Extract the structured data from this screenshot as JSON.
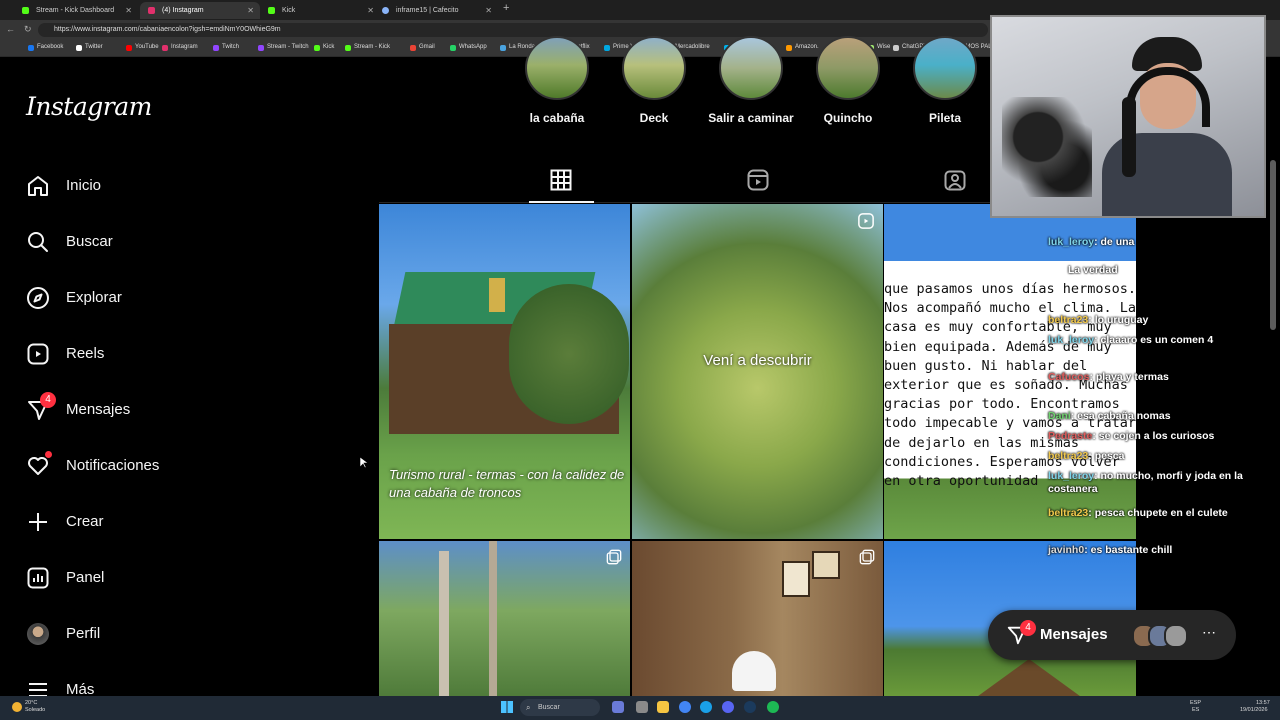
{
  "browser": {
    "tabs": [
      {
        "label": "Stream - Kick Dashboard",
        "color": "#53fc18"
      },
      {
        "label": "(4) Instagram",
        "color": "#e1306c"
      },
      {
        "label": "Kick",
        "color": "#53fc18"
      },
      {
        "label": "inframe15 | Cafecito",
        "color": "#8ab4f8"
      }
    ],
    "url": "https://www.instagram.com/cabaniaencolon?igsh=emdiNmY0OWhieG9m",
    "bookmarks": [
      {
        "label": "Facebook",
        "color": "#1877f2"
      },
      {
        "label": "Twitter",
        "color": "#ffffff"
      },
      {
        "label": "YouTube",
        "color": "#ff0000"
      },
      {
        "label": "Instagram",
        "color": "#e1306c"
      },
      {
        "label": "Twitch",
        "color": "#9146ff"
      },
      {
        "label": "Stream - Twitch",
        "color": "#9146ff"
      },
      {
        "label": "Kick",
        "color": "#53fc18"
      },
      {
        "label": "Stream - Kick",
        "color": "#53fc18"
      },
      {
        "label": "Gmail",
        "color": "#ea4335"
      },
      {
        "label": "WhatsApp",
        "color": "#25d366"
      },
      {
        "label": "La Ronda Simracing",
        "color": "#4aa3df"
      },
      {
        "label": "Netflix",
        "color": "#e50914"
      },
      {
        "label": "Prime Video",
        "color": "#00a8e1"
      },
      {
        "label": "Mercadolibre",
        "color": "#ffe600"
      },
      {
        "label": "Mercadopago",
        "color": "#00b1ea"
      },
      {
        "label": "Amazon.",
        "color": "#ff9900"
      },
      {
        "label": "PayPal",
        "color": "#0070ba"
      },
      {
        "label": "Wise",
        "color": "#9fe870"
      },
      {
        "label": "ChatGPT",
        "color": "#cccccc"
      },
      {
        "label": "DEMOS PAL STR",
        "color": "#cccccc"
      }
    ]
  },
  "sidebar": {
    "logo": "Instagram",
    "items": [
      {
        "label": "Inicio",
        "icon": "home-icon"
      },
      {
        "label": "Buscar",
        "icon": "search-icon"
      },
      {
        "label": "Explorar",
        "icon": "compass-icon"
      },
      {
        "label": "Reels",
        "icon": "reels-icon"
      },
      {
        "label": "Mensajes",
        "icon": "messenger-icon",
        "badge": "4"
      },
      {
        "label": "Notificaciones",
        "icon": "heart-icon"
      },
      {
        "label": "Crear",
        "icon": "plus-icon"
      },
      {
        "label": "Panel",
        "icon": "dashboard-icon"
      },
      {
        "label": "Perfil",
        "icon": "avatar"
      },
      {
        "label": "Más",
        "icon": "menu-icon"
      }
    ]
  },
  "highlights": [
    {
      "label": "la cabaña"
    },
    {
      "label": "Deck"
    },
    {
      "label": "Salir a caminar"
    },
    {
      "label": "Quincho"
    },
    {
      "label": "Pileta"
    }
  ],
  "profile_tabs": [
    "grid-icon",
    "reels-icon",
    "tagged-icon"
  ],
  "posts": [
    {
      "overlay": "Turismo rural - termas - con la calidez de una cabaña de troncos"
    },
    {
      "overlay": "Vení a descubrir"
    },
    {
      "overlay": "que pasamos unos días hermosos. Nos acompañó mucho el clima. La casa es muy confortable, muy bien equipada. Además de muy buen gusto. Ni hablar del exterior que es soñado. Muchas gracias por todo. Encontramos todo impecable y vamos a tratar de dejarlo en las mismas condiciones. Esperamos volver en otra oportunidad"
    },
    {
      "overlay": ""
    },
    {
      "overlay": ""
    },
    {
      "overlay": ""
    }
  ],
  "chat": [
    {
      "user": "luk_leroy",
      "text": ": de una",
      "cls": ""
    },
    {
      "user": "",
      "text": "La verdad",
      "cls": ""
    },
    {
      "user": "beltra23",
      "text": ": lo uruguay",
      "cls": "y"
    },
    {
      "user": "luk_leroy",
      "text": ": claaaro es un comen 4",
      "cls": ""
    },
    {
      "user": "Cafucos",
      "text": ": playa y termas",
      "cls": "r"
    },
    {
      "user": "Dani",
      "text": ": esa cabaña nomas",
      "cls": "g"
    },
    {
      "user": "Pedraste",
      "text": ": se cojen a los curiosos",
      "cls": "r"
    },
    {
      "user": "beltra23",
      "text": ": pesca",
      "cls": "y"
    },
    {
      "user": "luk_leroy",
      "text": ": no mucho, morfi y joda en la costanera",
      "cls": ""
    },
    {
      "user": "beltra23",
      "text": ": pesca chupete en el culete",
      "cls": "y"
    },
    {
      "user": "javinh0",
      "text": ": es bastante chill",
      "cls": ""
    }
  ],
  "messages_pill": {
    "label": "Mensajes",
    "badge": "4"
  },
  "taskbar": {
    "weather_temp": "20°C",
    "weather_desc": "Soleado",
    "search": "Buscar",
    "lang": "ESP",
    "lang2": "ES",
    "time": "13:57",
    "date": "19/01/2026"
  }
}
